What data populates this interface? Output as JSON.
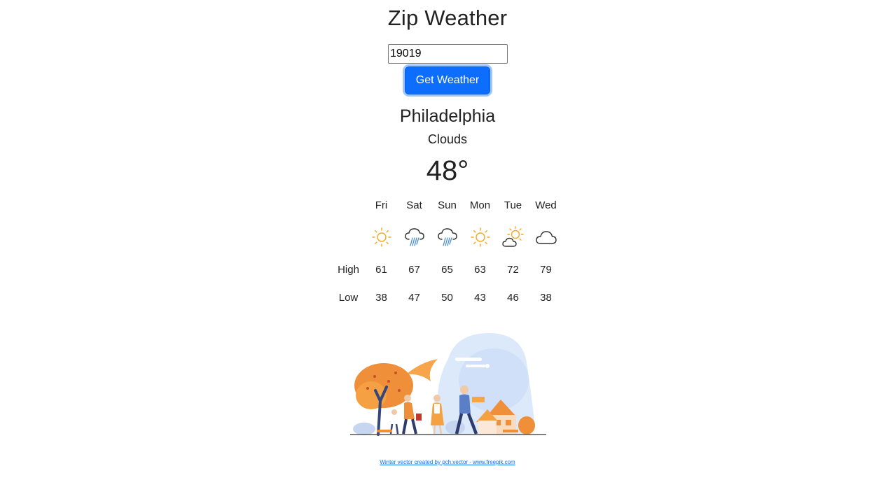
{
  "header": {
    "title": "Zip Weather"
  },
  "search": {
    "zip_value": "19019",
    "button_label": "Get Weather"
  },
  "current": {
    "city": "Philadelphia",
    "condition": "Clouds",
    "temperature": "48°"
  },
  "forecast": {
    "high_label": "High",
    "low_label": "Low",
    "days": [
      {
        "day": "Fri",
        "icon": "sun-icon",
        "high": "61",
        "low": "38"
      },
      {
        "day": "Sat",
        "icon": "rain-cloud-icon",
        "high": "67",
        "low": "47"
      },
      {
        "day": "Sun",
        "icon": "rain-cloud-icon",
        "high": "65",
        "low": "50"
      },
      {
        "day": "Mon",
        "icon": "sun-icon",
        "high": "63",
        "low": "43"
      },
      {
        "day": "Tue",
        "icon": "partly-cloudy-icon",
        "high": "72",
        "low": "46"
      },
      {
        "day": "Wed",
        "icon": "cloud-icon",
        "high": "79",
        "low": "38"
      }
    ]
  },
  "footer": {
    "credit": "Winter vector created by pch.vector - www.freepik.com"
  },
  "colors": {
    "accent": "#0d6efd",
    "sun": "#f5a623",
    "cloud": "#333333",
    "rain": "#4a90d9"
  }
}
